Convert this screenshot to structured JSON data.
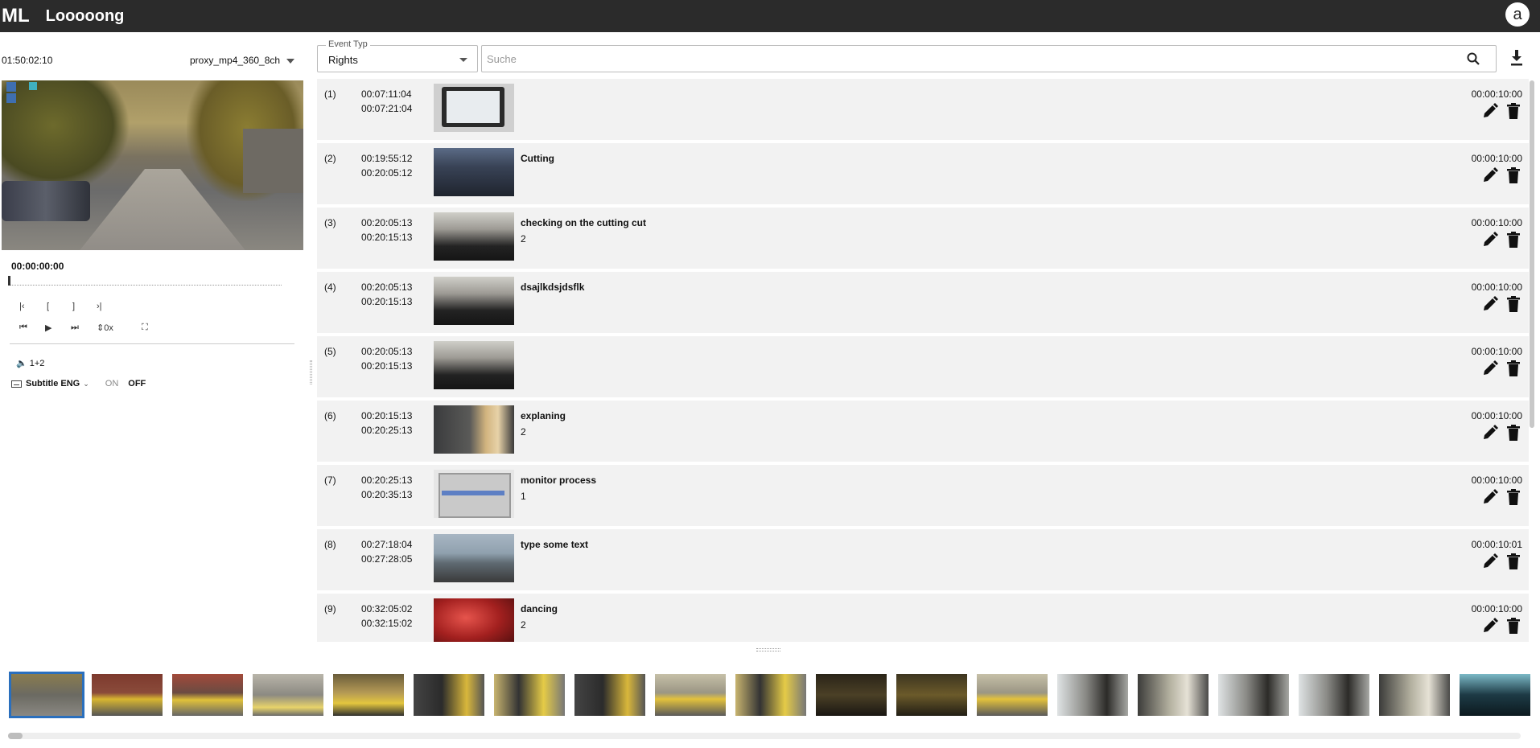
{
  "header": {
    "logo": "ML",
    "title": "Looooong",
    "avatar": "a"
  },
  "player": {
    "total_duration": "01:50:02:10",
    "proxy_format": "proxy_mp4_360_8ch",
    "current_time": "00:00:00:00",
    "speed_label": "0x",
    "audio_channels": "1+2",
    "subtitle_label": "Subtitle ENG",
    "subtitle_on": "ON",
    "subtitle_off": "OFF"
  },
  "filters": {
    "event_type_legend": "Event Typ",
    "event_type_value": "Rights",
    "search_placeholder": "Suche"
  },
  "events": [
    {
      "idx": "(1)",
      "tc_in": "00:07:11:04",
      "tc_out": "00:07:21:04",
      "title": "",
      "count": "",
      "duration": "00:00:10:00",
      "thumb": "t-tablet"
    },
    {
      "idx": "(2)",
      "tc_in": "00:19:55:12",
      "tc_out": "00:20:05:12",
      "title": "Cutting",
      "count": "",
      "duration": "00:00:10:00",
      "thumb": "t-office"
    },
    {
      "idx": "(3)",
      "tc_in": "00:20:05:13",
      "tc_out": "00:20:15:13",
      "title": "checking on the cutting cut",
      "count": "2",
      "duration": "00:00:10:00",
      "thumb": "t-people"
    },
    {
      "idx": "(4)",
      "tc_in": "00:20:05:13",
      "tc_out": "00:20:15:13",
      "title": "dsajlkdsjdsflk",
      "count": "",
      "duration": "00:00:10:00",
      "thumb": "t-people"
    },
    {
      "idx": "(5)",
      "tc_in": "00:20:05:13",
      "tc_out": "00:20:15:13",
      "title": "",
      "count": "",
      "duration": "00:00:10:00",
      "thumb": "t-people"
    },
    {
      "idx": "(6)",
      "tc_in": "00:20:15:13",
      "tc_out": "00:20:25:13",
      "title": "explaning",
      "count": "2",
      "duration": "00:00:10:00",
      "thumb": "t-people2"
    },
    {
      "idx": "(7)",
      "tc_in": "00:20:25:13",
      "tc_out": "00:20:35:13",
      "title": "monitor process",
      "count": "1",
      "duration": "00:00:10:00",
      "thumb": "t-screen"
    },
    {
      "idx": "(8)",
      "tc_in": "00:27:18:04",
      "tc_out": "00:27:28:05",
      "title": "type some text",
      "count": "",
      "duration": "00:00:10:01",
      "thumb": "t-lake"
    },
    {
      "idx": "(9)",
      "tc_in": "00:32:05:02",
      "tc_out": "00:32:15:02",
      "title": "dancing",
      "count": "2",
      "duration": "00:00:10:00",
      "thumb": "t-dance"
    }
  ],
  "filmstrip": [
    "f-street",
    "f-yellowcar",
    "f-yellowcar2",
    "f-parking",
    "f-carin",
    "f-men",
    "f-men2",
    "f-men",
    "f-road",
    "f-men2",
    "f-dark",
    "f-dark2",
    "f-road",
    "f-interior",
    "f-interior2",
    "f-interior",
    "f-interior",
    "f-interior2",
    "f-night"
  ],
  "icons": {
    "search": "search-icon",
    "download": "download-icon",
    "edit": "pencil-icon",
    "delete": "trash-icon"
  }
}
